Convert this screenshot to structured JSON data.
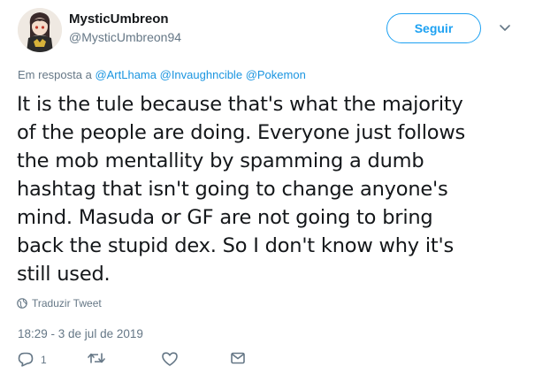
{
  "user": {
    "display_name": "MysticUmbreon",
    "handle": "@MysticUmbreon94"
  },
  "follow_button": {
    "label": "Seguir"
  },
  "reply_context": {
    "prefix": "Em resposta a ",
    "mentions": [
      "@ArtLhama",
      "@Invaughncible",
      "@Pokemon"
    ]
  },
  "tweet": {
    "text": "It is the tule because that's what the majority\nof the people are doing. Everyone just follows\nthe mob mentallity by spamming a dumb\nhashtag that isn't going to change anyone's\nmind. Masuda or GF are not going to bring\nback the stupid dex. So I don't know why it's\nstill used."
  },
  "translate": {
    "label": "Traduzir Tweet",
    "icon": "globe-icon"
  },
  "timestamp": "18:29 - 3 de jul de 2019",
  "actions": {
    "reply_count": "1",
    "icons": [
      "reply-icon",
      "retweet-icon",
      "like-icon",
      "message-icon"
    ]
  },
  "colors": {
    "accent": "#1da1f2",
    "link": "#1b95e0",
    "secondary_text": "#657786",
    "primary_text": "#14171a"
  }
}
